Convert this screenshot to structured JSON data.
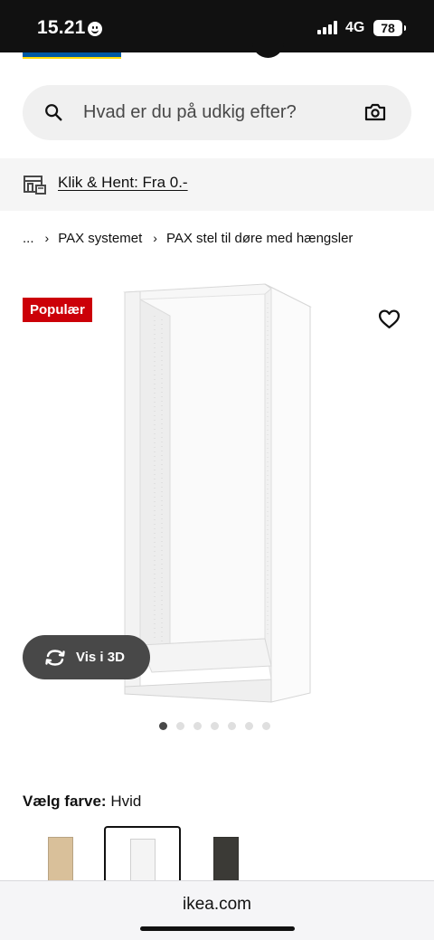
{
  "status_bar": {
    "time": "15.21",
    "network": "4G",
    "battery": "78"
  },
  "search": {
    "placeholder": "Hvad er du på udkig efter?"
  },
  "click_hent": {
    "label": "Klik & Hent: Fra 0.-"
  },
  "breadcrumb": {
    "ellipsis": "...",
    "items": [
      "PAX systemet",
      "PAX stel til døre med hængsler"
    ]
  },
  "product": {
    "badge": "Populær",
    "view_3d_label": "Vis i 3D",
    "image_count": 7,
    "active_image_index": 0
  },
  "color_select": {
    "label": "Vælg farve:",
    "value": "Hvid",
    "swatches": [
      {
        "name": "white stained oak effect",
        "color": "#d9c09a",
        "selected": false
      },
      {
        "name": "white",
        "color": "#f4f4f4",
        "selected": true
      },
      {
        "name": "dark grey",
        "color": "#3b3a36",
        "selected": false
      }
    ]
  },
  "browser": {
    "url": "ikea.com"
  },
  "colors": {
    "brand_blue": "#0058a3",
    "brand_yellow": "#ffdb00",
    "badge_red": "#cc0008"
  }
}
